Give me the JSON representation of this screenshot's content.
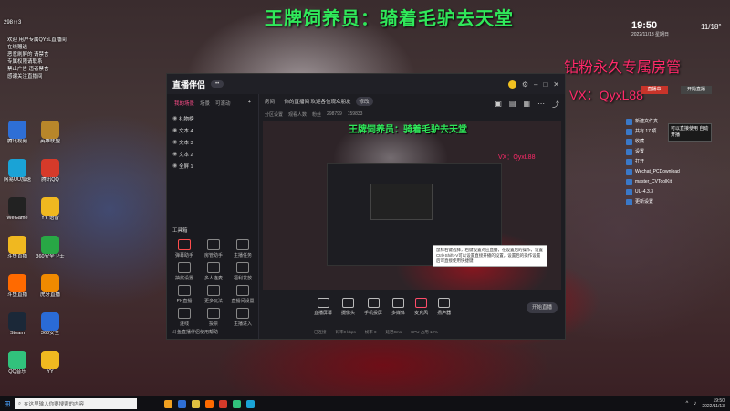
{
  "overlay": {
    "title": "王牌饲养员：骑着毛驴去天堂",
    "sub1": "钻粉永久专属房管",
    "sub2": "VX：QyxL88"
  },
  "desktop": {
    "top_counter": "298↑↑3",
    "list": [
      "欢迎 用户专属QYxL直播间",
      "在线赠送",
      "恶意刷屏的 请禁言",
      "专属权限请联系",
      "禁止广告 违者禁言",
      "感谢关注直播间"
    ],
    "icons": [
      {
        "label": "腾讯视频",
        "color": "#2e6fd6"
      },
      {
        "label": "英雄联盟",
        "color": "#b8862a"
      },
      {
        "label": "网易UU加速",
        "color": "#1aa3d6"
      },
      {
        "label": "腾讯QQ",
        "color": "#d63a2a"
      },
      {
        "label": "WeGame",
        "color": "#222222"
      },
      {
        "label": "YY 语音",
        "color": "#f0b820"
      },
      {
        "label": "斗鱼直播",
        "color": "#f0b820"
      },
      {
        "label": "360安全卫士",
        "color": "#28a745"
      },
      {
        "label": "斗鱼直播",
        "color": "#ff6a00"
      },
      {
        "label": "虎牙直播",
        "color": "#f08a00"
      },
      {
        "label": "Steam",
        "color": "#1b2838"
      },
      {
        "label": "360安全",
        "color": "#2a6bd6"
      },
      {
        "label": "QQ音乐",
        "color": "#31c27c"
      },
      {
        "label": "YY",
        "color": "#f0b820"
      }
    ]
  },
  "app": {
    "name": "直播伴侣",
    "version_badge": "",
    "tabs": [
      "我的场景",
      "场景",
      "可滚动"
    ],
    "scenes": [
      "礼物榜",
      "文本 4",
      "文本 3",
      "文本 2",
      "全屏 1"
    ],
    "tools_title": "工具箱",
    "tools": [
      "弹幕助手",
      "房管助手",
      "主播任务",
      "抽奖设置",
      "多人连麦",
      "福利发放",
      "PK直播",
      "更多玩法",
      "直播间设置",
      "连线",
      "投票",
      "主播进入"
    ],
    "bottom_note": "斗鱼直播伴侣使用帮助",
    "room_label": "房间：",
    "room_title": "你的直播间 欢迎各位观众朋友",
    "room_pill": "修改",
    "info_items": [
      "分区设置",
      "观看人数",
      "粉丝",
      "298799",
      "159833"
    ],
    "preview_banner": "王牌饲养员：骑着毛驴去天堂",
    "preview_vx": "VX：QyxL88",
    "tooltip": "鼠标右键选择，右键设置对应直播，在设置后的操作，设置Ctrl+Shift+V可以设置直接开播的设置，设置后的操作设置后可直接使用快捷键",
    "controls": [
      "直播屏幕",
      "摄像头",
      "手机投屏",
      "多媒体",
      "麦克风",
      "扬声器"
    ],
    "start_button": "开始直播",
    "status": [
      "已连接",
      "码率0 kbps",
      "帧率 0",
      "延迟0ms",
      "CPU 占用 12%"
    ]
  },
  "tray_overlay": {
    "time": "19:50",
    "date": "2022/11/13 星期日",
    "temp": "11/18°",
    "btn_red": "直播中",
    "btn_white": "开始直播",
    "files": [
      "新建文件夹",
      "共有 17 项",
      "收藏",
      "设置",
      "打开",
      "Wechat_PCDownload",
      "master_CVToolKit",
      "UU-4.3.3",
      "更新设置"
    ],
    "popup": "可以直接使用 自动开播"
  },
  "taskbar": {
    "search_placeholder": "在这里输入你要搜索的内容",
    "time": "19:50",
    "date": "2022/11/13"
  }
}
